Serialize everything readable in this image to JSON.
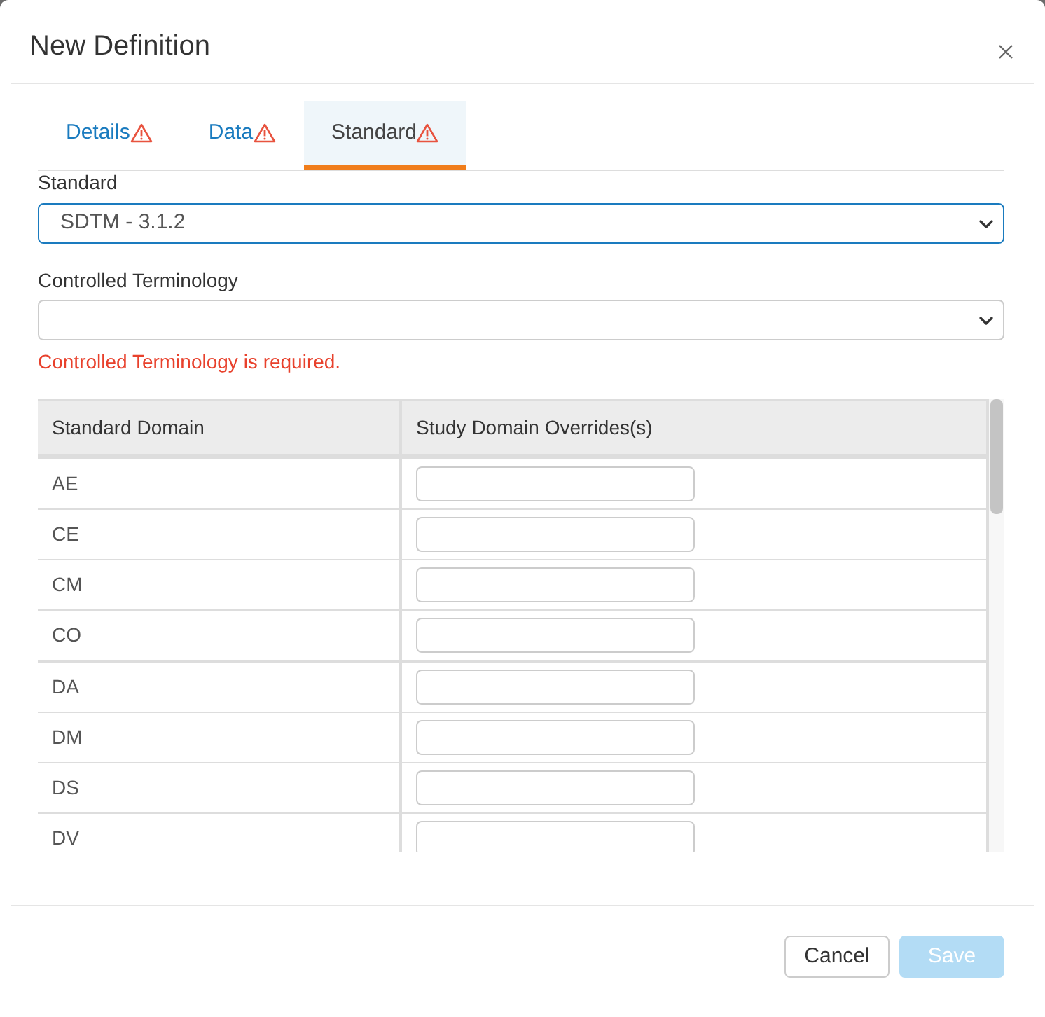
{
  "dialog": {
    "title": "New Definition"
  },
  "tabs": [
    {
      "label": "Details",
      "selected": false,
      "warning": true
    },
    {
      "label": "Data",
      "selected": false,
      "warning": true
    },
    {
      "label": "Standard",
      "selected": true,
      "warning": true
    }
  ],
  "fields": [
    {
      "label": "Standard",
      "value": "SDTM - 3.1.2",
      "focused": true
    },
    {
      "label": "Controlled Terminology",
      "focused": false,
      "error": "Controlled Terminology is required."
    }
  ],
  "table": {
    "columns": [
      "Standard Domain",
      "Study Domain Overrides(s)"
    ],
    "rows": [
      {
        "domain": "AE"
      },
      {
        "domain": "CE"
      },
      {
        "domain": "CM"
      },
      {
        "domain": "CO"
      },
      {
        "domain": "DA"
      },
      {
        "domain": "DM"
      },
      {
        "domain": "DS"
      },
      {
        "domain": "DV"
      }
    ]
  },
  "buttons": [
    {
      "label": "Cancel",
      "kind": "default",
      "disabled": false
    },
    {
      "label": "Save",
      "kind": "primary",
      "disabled": true
    }
  ]
}
